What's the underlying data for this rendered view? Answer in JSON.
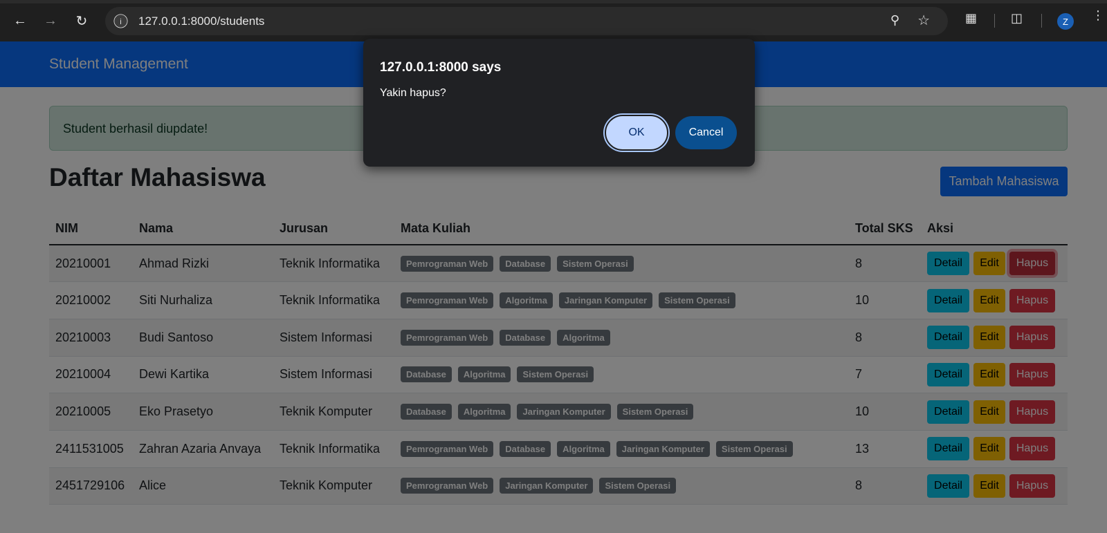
{
  "browser": {
    "url": "127.0.0.1:8000/students",
    "profile_initial": "Z"
  },
  "navbar": {
    "brand": "Student Management"
  },
  "alert": {
    "text": "Student berhasil diupdate!"
  },
  "main": {
    "title": "Daftar Mahasiswa",
    "add_button": "Tambah Mahasiswa"
  },
  "table": {
    "headers": [
      "NIM",
      "Nama",
      "Jurusan",
      "Mata Kuliah",
      "Total SKS",
      "Aksi"
    ],
    "rows": [
      {
        "nim": "20210001",
        "nama": "Ahmad Rizki",
        "jurusan": "Teknik Informatika",
        "mata_kuliah": [
          "Pemrograman Web",
          "Database",
          "Sistem Operasi"
        ],
        "sks": "8"
      },
      {
        "nim": "20210002",
        "nama": "Siti Nurhaliza",
        "jurusan": "Teknik Informatika",
        "mata_kuliah": [
          "Pemrograman Web",
          "Algoritma",
          "Jaringan Komputer",
          "Sistem Operasi"
        ],
        "sks": "10"
      },
      {
        "nim": "20210003",
        "nama": "Budi Santoso",
        "jurusan": "Sistem Informasi",
        "mata_kuliah": [
          "Pemrograman Web",
          "Database",
          "Algoritma"
        ],
        "sks": "8"
      },
      {
        "nim": "20210004",
        "nama": "Dewi Kartika",
        "jurusan": "Sistem Informasi",
        "mata_kuliah": [
          "Database",
          "Algoritma",
          "Sistem Operasi"
        ],
        "sks": "7"
      },
      {
        "nim": "20210005",
        "nama": "Eko Prasetyo",
        "jurusan": "Teknik Komputer",
        "mata_kuliah": [
          "Database",
          "Algoritma",
          "Jaringan Komputer",
          "Sistem Operasi"
        ],
        "sks": "10"
      },
      {
        "nim": "2411531005",
        "nama": "Zahran Azaria Anvaya",
        "jurusan": "Teknik Informatika",
        "mata_kuliah": [
          "Pemrograman Web",
          "Database",
          "Algoritma",
          "Jaringan Komputer",
          "Sistem Operasi"
        ],
        "sks": "13"
      },
      {
        "nim": "2451729106",
        "nama": "Alice",
        "jurusan": "Teknik Komputer",
        "mata_kuliah": [
          "Pemrograman Web",
          "Jaringan Komputer",
          "Sistem Operasi"
        ],
        "sks": "8"
      }
    ],
    "actions": {
      "detail": "Detail",
      "edit": "Edit",
      "hapus": "Hapus"
    }
  },
  "dialog": {
    "title": "127.0.0.1:8000 says",
    "message": "Yakin hapus?",
    "ok": "OK",
    "cancel": "Cancel"
  },
  "icons": {
    "back": "back-arrow-icon",
    "forward": "forward-arrow-icon",
    "reload": "reload-icon",
    "info": "info-icon",
    "zoom": "zoom-icon",
    "bookmark": "star-icon",
    "extensions": "puzzle-icon",
    "cast": "cast-search-icon",
    "menu": "kebab-menu-icon"
  }
}
